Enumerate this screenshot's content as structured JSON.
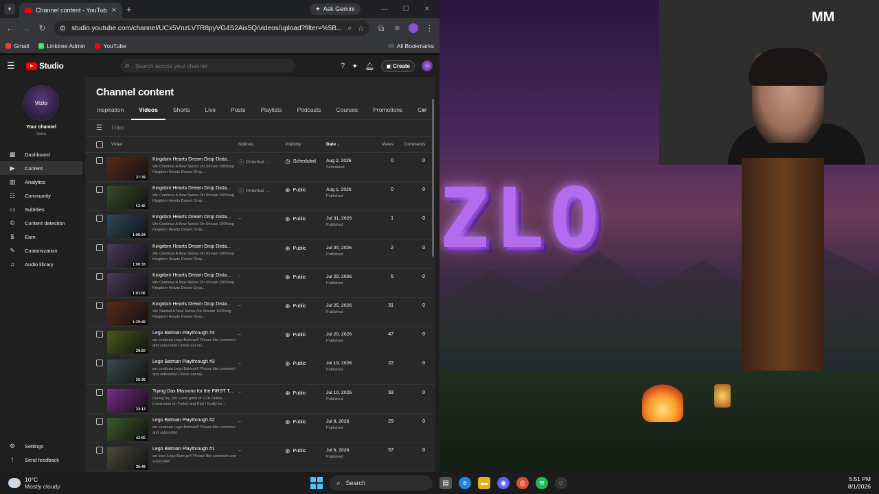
{
  "browser": {
    "tab_title": "Channel content - YouTube Studio",
    "ask_gemini": "Ask Gemini",
    "url": "studio.youtube.com/channel/UCx5VnzLVTR8pyVG4S2Ais5Q/videos/upload?filter=%5B...",
    "bookmarks": [
      "Gmail",
      "Linktree Admin",
      "YouTube"
    ],
    "all_bookmarks": "All Bookmarks"
  },
  "studio": {
    "logo_text": "Studio",
    "search_placeholder": "Search across your channel",
    "create_label": "Create",
    "page_title": "Channel content",
    "channel_avatar_text": "Vizlo",
    "channel_label": "Your channel",
    "channel_name": "Vizlo",
    "nav": [
      {
        "label": "Dashboard",
        "icon": "dashboard-icon"
      },
      {
        "label": "Content",
        "icon": "content-icon"
      },
      {
        "label": "Analytics",
        "icon": "analytics-icon"
      },
      {
        "label": "Community",
        "icon": "community-icon"
      },
      {
        "label": "Subtitles",
        "icon": "subtitles-icon"
      },
      {
        "label": "Content detection",
        "icon": "copyright-icon"
      },
      {
        "label": "Earn",
        "icon": "earn-icon"
      },
      {
        "label": "Customization",
        "icon": "customization-icon"
      },
      {
        "label": "Audio library",
        "icon": "audio-library-icon"
      }
    ],
    "nav_bottom": [
      {
        "label": "Settings",
        "icon": "settings-icon"
      },
      {
        "label": "Send feedback",
        "icon": "feedback-icon"
      }
    ],
    "tabs": [
      "Inspiration",
      "Videos",
      "Shorts",
      "Live",
      "Posts",
      "Playlists",
      "Podcasts",
      "Courses",
      "Promotions",
      "Col"
    ],
    "active_tab": "Videos",
    "filter_label": "Filter",
    "columns": {
      "video": "Video",
      "notices": "Notices",
      "visibility": "Visibility",
      "date": "Date",
      "views": "Views",
      "comments": "Comments"
    },
    "rows": [
      {
        "title": "Kingdom Hearts Dream Drop Dista...",
        "desc": "We Continue A New Series On Stream 100%ing Kingdom Hearts Dream Drop...",
        "duration": "37:39",
        "notice": "Potential ...",
        "visibility": "Scheduled",
        "date": "Aug 2, 2026",
        "status": "Scheduled",
        "views": "0",
        "comments": "0",
        "thumb": "#5a2a1a"
      },
      {
        "title": "Kingdom Hearts Dream Drop Dista...",
        "desc": "We Continue A New Series On Stream 100%ing Kingdom Hearts Dream Drop...",
        "duration": "52:46",
        "notice": "Potential ...",
        "visibility": "Public",
        "date": "Aug 1, 2026",
        "status": "Published",
        "views": "0",
        "comments": "0",
        "thumb": "#3a4a2a"
      },
      {
        "title": "Kingdom Hearts Dream Drop Dista...",
        "desc": "We Continue A New Series On Stream 100%ing Kingdom Hearts Dream Drop...",
        "duration": "1:06:24",
        "notice": "–",
        "visibility": "Public",
        "date": "Jul 31, 2026",
        "status": "Published",
        "views": "1",
        "comments": "0",
        "thumb": "#2a4a5a"
      },
      {
        "title": "Kingdom Hearts Dream Drop Dista...",
        "desc": "We Continue A New Series On Stream 100%ing Kingdom Hearts Dream Drop...",
        "duration": "1:00:33",
        "notice": "–",
        "visibility": "Public",
        "date": "Jul 30, 2026",
        "status": "Published",
        "views": "2",
        "comments": "0",
        "thumb": "#4a3a5a"
      },
      {
        "title": "Kingdom Hearts Dream Drop Dista...",
        "desc": "We Continue A New Series On Stream 100%ing Kingdom Hearts Dream Drop...",
        "duration": "1:01:06",
        "notice": "–",
        "visibility": "Public",
        "date": "Jul 29, 2026",
        "status": "Published",
        "views": "6",
        "comments": "0",
        "thumb": "#4a3a5a"
      },
      {
        "title": "Kingdom Hearts Dream Drop Dista...",
        "desc": "We Started A New Series On Stream 100%ing Kingdom Hearts Dream Drop...",
        "duration": "1:29:49",
        "notice": "–",
        "visibility": "Public",
        "date": "Jul 25, 2026",
        "status": "Published",
        "views": "31",
        "comments": "0",
        "thumb": "#5a2a1a"
      },
      {
        "title": "Lego Batman Playthrough #4",
        "desc": "we continue Lego Batman!! Please like comment and subscribe! Check out my...",
        "duration": "29:50",
        "notice": "–",
        "visibility": "Public",
        "date": "Jul 20, 2026",
        "status": "Published",
        "views": "47",
        "comments": "0",
        "thumb": "#4a5a1a"
      },
      {
        "title": "Lego Batman Playthrough #3",
        "desc": "we continue Lego Batman!! Please like comment and subscribe! Check out my...",
        "duration": "25:36",
        "notice": "–",
        "visibility": "Public",
        "date": "Jul 19, 2026",
        "status": "Published",
        "views": "22",
        "comments": "0",
        "thumb": "#3a4a4a"
      },
      {
        "title": "Trying Dax Missions for the FIRST T...",
        "desc": "During my 100 Level grind of GTA Online Livestream on Twitch and Kick i finally be...",
        "duration": "33:13",
        "notice": "–",
        "visibility": "Public",
        "date": "Jul 10, 2026",
        "status": "Published",
        "views": "93",
        "comments": "0",
        "thumb": "#7a2a8a"
      },
      {
        "title": "Lego Batman Playthrough #2",
        "desc": "we continue Lego Batman!! Please like comment and subscribe!",
        "duration": "42:55",
        "notice": "–",
        "visibility": "Public",
        "date": "Jul 8, 2026",
        "status": "Published",
        "views": "29",
        "comments": "0",
        "thumb": "#3a5a2a"
      },
      {
        "title": "Lego Batman Playthrough #1",
        "desc": "we start Lego Batman!! Please like comment and subscribe!",
        "duration": "30:49",
        "notice": "–",
        "visibility": "Public",
        "date": "Jul 6, 2026",
        "status": "Published",
        "views": "57",
        "comments": "0",
        "thumb": "#4a4a3a"
      }
    ]
  },
  "desktop": {
    "logo": "MM",
    "title_text": "ZLO"
  },
  "taskbar": {
    "temp": "10°C",
    "weather": "Mostly cloudy",
    "search": "Search",
    "time": "5:51 PM",
    "date": "8/1/2026"
  }
}
